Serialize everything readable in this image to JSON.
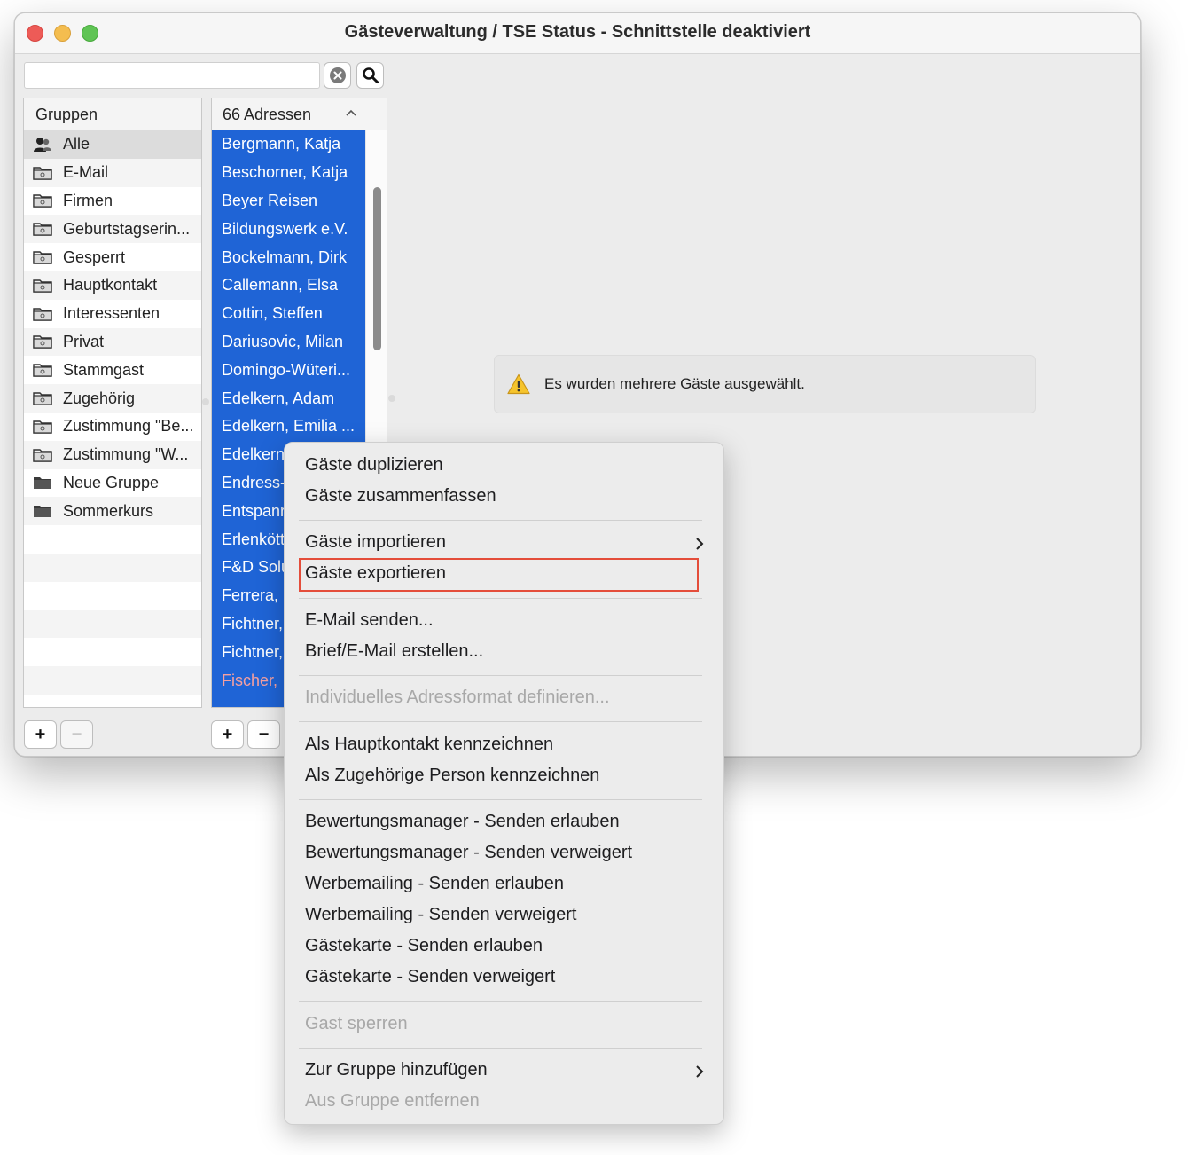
{
  "window": {
    "title": "Gästeverwaltung / TSE Status - Schnittstelle deaktiviert"
  },
  "search": {
    "value": "",
    "placeholder": ""
  },
  "groups": {
    "header": "Gruppen",
    "items": [
      {
        "label": "Alle",
        "icon": "users-icon"
      },
      {
        "label": "E-Mail",
        "icon": "smart-folder-icon"
      },
      {
        "label": "Firmen",
        "icon": "smart-folder-icon"
      },
      {
        "label": "Geburtstagserin...",
        "icon": "smart-folder-icon"
      },
      {
        "label": "Gesperrt",
        "icon": "smart-folder-icon"
      },
      {
        "label": "Hauptkontakt",
        "icon": "smart-folder-icon"
      },
      {
        "label": "Interessenten",
        "icon": "smart-folder-icon"
      },
      {
        "label": "Privat",
        "icon": "smart-folder-icon"
      },
      {
        "label": "Stammgast",
        "icon": "smart-folder-icon"
      },
      {
        "label": "Zugehörig",
        "icon": "smart-folder-icon"
      },
      {
        "label": "Zustimmung \"Be...",
        "icon": "smart-folder-icon"
      },
      {
        "label": "Zustimmung \"W...",
        "icon": "smart-folder-icon"
      },
      {
        "label": "Neue Gruppe",
        "icon": "folder-icon"
      },
      {
        "label": "Sommerkurs",
        "icon": "folder-icon"
      }
    ],
    "add_label": "+",
    "remove_label": "−"
  },
  "addresses": {
    "header": "66 Adressen",
    "items": [
      "Bergmann, Katja",
      "Beschorner, Katja",
      "Beyer Reisen",
      "Bildungswerk e.V.",
      "Bockelmann, Dirk",
      "Callemann, Elsa",
      "Cottin, Steffen",
      "Dariusovic, Milan",
      "Domingo-Wüteri...",
      "Edelkern, Adam",
      "Edelkern, Emilia ...",
      "Edelkern",
      "Endress-",
      "Entspanr",
      "Erlenkött",
      "F&D Solu",
      "Ferrera,",
      "Fichtner,",
      "Fichtner,",
      "Fischer,"
    ],
    "flagged_index": 19,
    "add_label": "+",
    "remove_label": "−"
  },
  "info": {
    "message": "Es wurden mehrere Gäste ausgewählt."
  },
  "context_menu": {
    "items": [
      {
        "label": "Gäste duplizieren"
      },
      {
        "label": "Gäste zusammenfassen"
      },
      {
        "label": "Gäste importieren"
      },
      {
        "label": "Gäste exportieren"
      },
      {
        "label": "E-Mail senden..."
      },
      {
        "label": "Brief/E-Mail erstellen..."
      },
      {
        "label": "Individuelles Adressformat definieren..."
      },
      {
        "label": "Als Hauptkontakt kennzeichnen"
      },
      {
        "label": "Als Zugehörige Person kennzeichnen"
      },
      {
        "label": "Bewertungsmanager - Senden erlauben"
      },
      {
        "label": "Bewertungsmanager - Senden verweigert"
      },
      {
        "label": "Werbemailing - Senden erlauben"
      },
      {
        "label": "Werbemailing - Senden verweigert"
      },
      {
        "label": "Gästekarte - Senden erlauben"
      },
      {
        "label": "Gästekarte - Senden verweigert"
      },
      {
        "label": "Gast sperren"
      },
      {
        "label": "Zur Gruppe hinzufügen"
      },
      {
        "label": "Aus Gruppe entfernen"
      }
    ]
  },
  "colors": {
    "selection_blue": "#1f64d6",
    "highlight_red": "#e44d3a",
    "warning_yellow": "#f6c42c"
  }
}
